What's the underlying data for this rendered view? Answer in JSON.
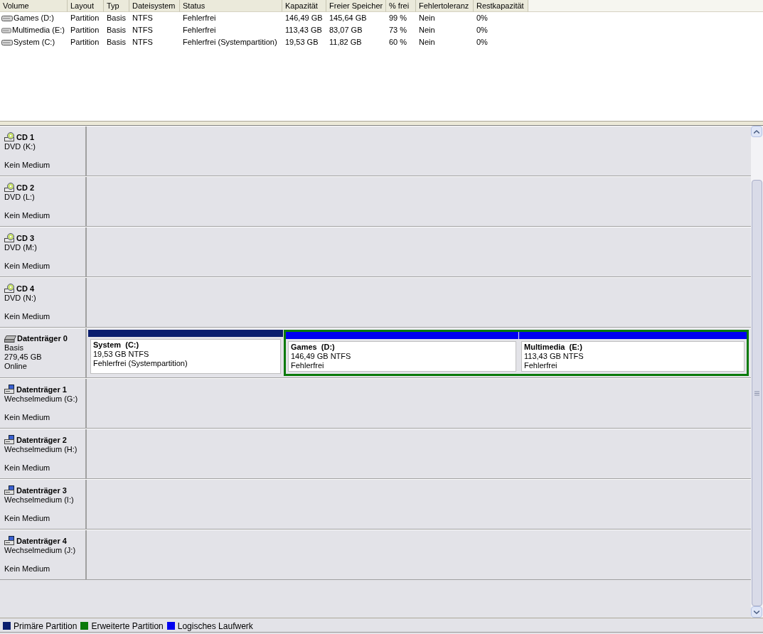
{
  "volume_list": {
    "columns": [
      "Volume",
      "Layout",
      "Typ",
      "Dateisystem",
      "Status",
      "Kapazität",
      "Freier Speicher",
      "% frei",
      "Fehlertoleranz",
      "Restkapazität"
    ],
    "rows": [
      [
        "Games (D:)",
        "Partition",
        "Basis",
        "NTFS",
        "Fehlerfrei",
        "146,49 GB",
        "145,64 GB",
        "99 %",
        "Nein",
        "0%"
      ],
      [
        "Multimedia (E:)",
        "Partition",
        "Basis",
        "NTFS",
        "Fehlerfrei",
        "113,43 GB",
        "83,07 GB",
        "73 %",
        "Nein",
        "0%"
      ],
      [
        "System (C:)",
        "Partition",
        "Basis",
        "NTFS",
        "Fehlerfrei (Systempartition)",
        "19,53 GB",
        "11,82 GB",
        "60 %",
        "Nein",
        "0%"
      ]
    ]
  },
  "disks": [
    {
      "kind": "cd",
      "name": "CD 1",
      "type": "DVD (K:)",
      "status": "Kein Medium"
    },
    {
      "kind": "cd",
      "name": "CD 2",
      "type": "DVD (L:)",
      "status": "Kein Medium"
    },
    {
      "kind": "cd",
      "name": "CD 3",
      "type": "DVD (M:)",
      "status": "Kein Medium"
    },
    {
      "kind": "cd",
      "name": "CD 4",
      "type": "DVD (N:)",
      "status": "Kein Medium"
    },
    {
      "kind": "hdd",
      "name": "Datenträger 0",
      "type": "Basis",
      "capacity": "279,45 GB",
      "status": "Online",
      "partitions": [
        {
          "kind": "primary",
          "name": "System  (C:)",
          "size": "19,53 GB NTFS",
          "status": "Fehlerfrei (Systempartition)"
        },
        {
          "kind": "extended",
          "children": [
            {
              "kind": "logical",
              "name": "Games  (D:)",
              "size": "146,49 GB NTFS",
              "status": "Fehlerfrei"
            },
            {
              "kind": "logical",
              "name": "Multimedia  (E:)",
              "size": "113,43 GB NTFS",
              "status": "Fehlerfrei"
            }
          ]
        }
      ]
    },
    {
      "kind": "removable",
      "name": "Datenträger 1",
      "type": "Wechselmedium (G:)",
      "status": "Kein Medium"
    },
    {
      "kind": "removable",
      "name": "Datenträger 2",
      "type": "Wechselmedium (H:)",
      "status": "Kein Medium"
    },
    {
      "kind": "removable",
      "name": "Datenträger 3",
      "type": "Wechselmedium (I:)",
      "status": "Kein Medium"
    },
    {
      "kind": "removable",
      "name": "Datenträger 4",
      "type": "Wechselmedium (J:)",
      "status": "Kein Medium"
    }
  ],
  "legend": [
    {
      "label": "Primäre Partition",
      "color": "#0a1e6e"
    },
    {
      "label": "Erweiterte Partition",
      "color": "#0a7a0a"
    },
    {
      "label": "Logisches Laufwerk",
      "color": "#0000f0"
    }
  ]
}
